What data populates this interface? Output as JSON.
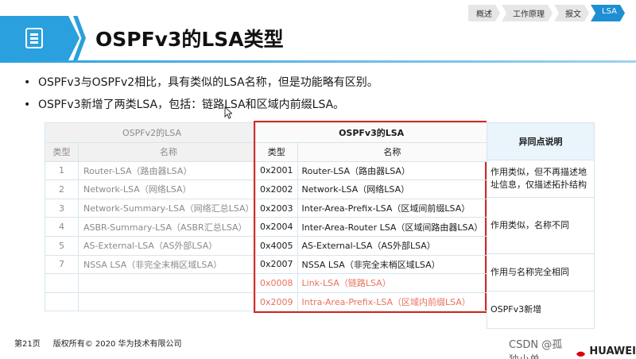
{
  "nav": {
    "tabs": [
      "概述",
      "工作原理",
      "报文",
      "LSA"
    ],
    "active_index": 3
  },
  "title": "OSPFv3的LSA类型",
  "bullets": [
    "OSPFv3与OSPFv2相比，具有类似的LSA名称，但是功能略有区别。",
    "OSPFv3新增了两类LSA，包括：链路LSA和区域内前缀LSA。"
  ],
  "ospfv2_table": {
    "title": "OSPFv2的LSA",
    "col_type": "类型",
    "col_name": "名称",
    "rows": [
      {
        "type": "1",
        "name": "Router-LSA（路由器LSA）"
      },
      {
        "type": "2",
        "name": "Network-LSA（网络LSA）"
      },
      {
        "type": "3",
        "name": "Network-Summary-LSA（网络汇总LSA）"
      },
      {
        "type": "4",
        "name": "ASBR-Summary-LSA（ASBR汇总LSA）"
      },
      {
        "type": "5",
        "name": "AS-External-LSA（AS外部LSA）"
      },
      {
        "type": "7",
        "name": "NSSA LSA（非完全末梢区域LSA）"
      },
      {
        "type": "",
        "name": ""
      },
      {
        "type": "",
        "name": ""
      }
    ]
  },
  "ospfv3_table": {
    "title": "OSPFv3的LSA",
    "col_type": "类型",
    "col_name": "名称",
    "rows": [
      {
        "type": "0x2001",
        "name": "Router-LSA（路由器LSA）"
      },
      {
        "type": "0x2002",
        "name": "Network-LSA（网络LSA）"
      },
      {
        "type": "0x2003",
        "name": "Inter-Area-Prefix-LSA（区域间前缀LSA）"
      },
      {
        "type": "0x2004",
        "name": "Inter-Area-Router LSA（区域间路由器LSA）"
      },
      {
        "type": "0x4005",
        "name": "AS-External-LSA（AS外部LSA）"
      },
      {
        "type": "0x2007",
        "name": "NSSA LSA（非完全末梢区域LSA）"
      },
      {
        "type": "0x0008",
        "name": "Link-LSA（链路LSA）"
      },
      {
        "type": "0x2009",
        "name": "Intra-Area-Prefix-LSA（区域内前缀LSA）"
      }
    ]
  },
  "notes": {
    "title": "异同点说明",
    "items": [
      "作用类似，但不再描述地址信息，仅描述拓扑结构",
      "作用类似，名称不同",
      "作用与名称完全相同",
      "OSPFv3新增"
    ]
  },
  "footer": {
    "page": "第21页",
    "copyright": "版权所有© 2020 华为技术有限公司"
  },
  "watermark": {
    "text": "CSDN @孤独小单",
    "brand": "HUAWEI"
  },
  "colors": {
    "accent": "#2aa0de",
    "highlight_border": "#d9281d",
    "new_row_text": "#e8715f"
  }
}
